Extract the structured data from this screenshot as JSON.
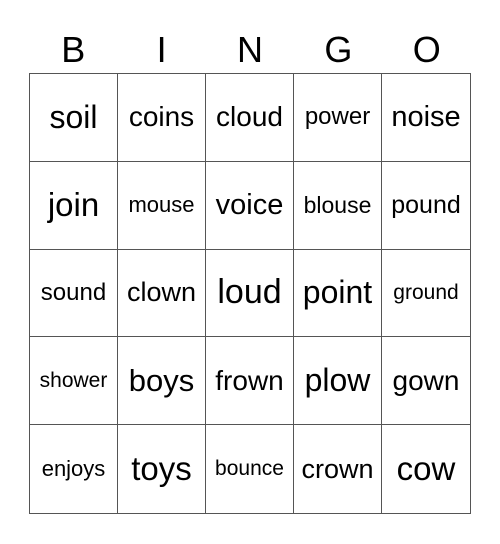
{
  "header": {
    "letters": [
      "B",
      "I",
      "N",
      "G",
      "O"
    ]
  },
  "card": {
    "cells": [
      "soil",
      "coins",
      "cloud",
      "power",
      "noise",
      "join",
      "mouse",
      "voice",
      "blouse",
      "pound",
      "sound",
      "clown",
      "loud",
      "point",
      "ground",
      "shower",
      "boys",
      "frown",
      "plow",
      "gown",
      "enjoys",
      "toys",
      "bounce",
      "crown",
      "cow"
    ]
  }
}
